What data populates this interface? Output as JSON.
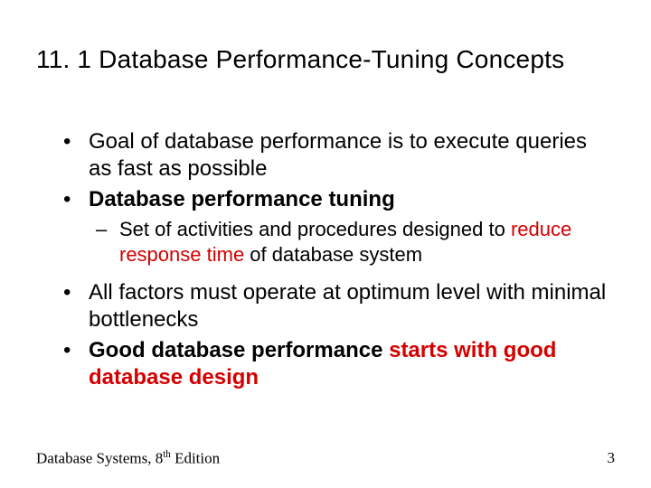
{
  "title": "11. 1 Database Performance-Tuning Concepts",
  "bullets": {
    "b1": "Goal of database performance is to execute queries as fast as possible",
    "b2": "Database performance tuning",
    "b2_sub_pre": "Set of activities and procedures designed to ",
    "b2_sub_red": "reduce response time",
    "b2_sub_post": " of database system",
    "b3": "All factors must operate at optimum level with minimal bottlenecks",
    "b4_pre": "Good database performance ",
    "b4_red": "starts with good database design"
  },
  "footer": {
    "left_pre": "Database Systems, 8",
    "left_sup": "th",
    "left_post": " Edition",
    "page": "3"
  }
}
